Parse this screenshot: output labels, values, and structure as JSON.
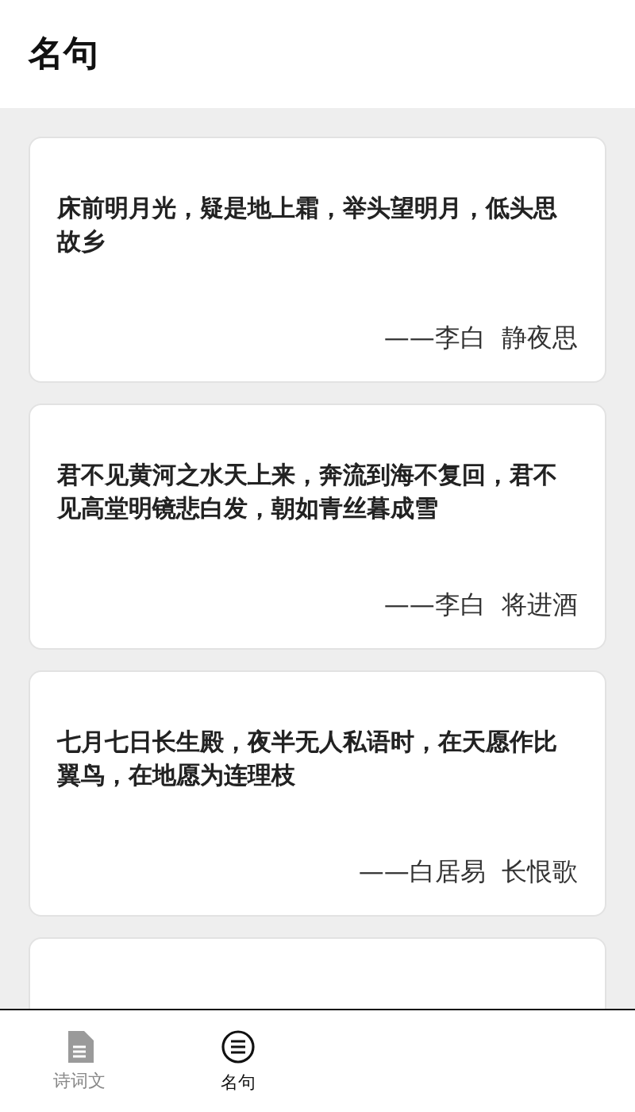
{
  "header": {
    "title": "名句"
  },
  "quotes": [
    {
      "text": "床前明月光，疑是地上霜，举头望明月，低头思故乡",
      "source": "——李白  静夜思"
    },
    {
      "text": "君不见黄河之水天上来，奔流到海不复回，君不见高堂明镜悲白发，朝如青丝暮成雪",
      "source": "——李白  将进酒"
    },
    {
      "text": "七月七日长生殿，夜半无人私语时，在天愿作比翼鸟，在地愿为连理枝",
      "source": "——白居易  长恨歌"
    }
  ],
  "tabs": [
    {
      "label": "诗词文",
      "kind": "doc",
      "selected": false
    },
    {
      "label": "名句",
      "kind": "list",
      "selected": true
    }
  ]
}
